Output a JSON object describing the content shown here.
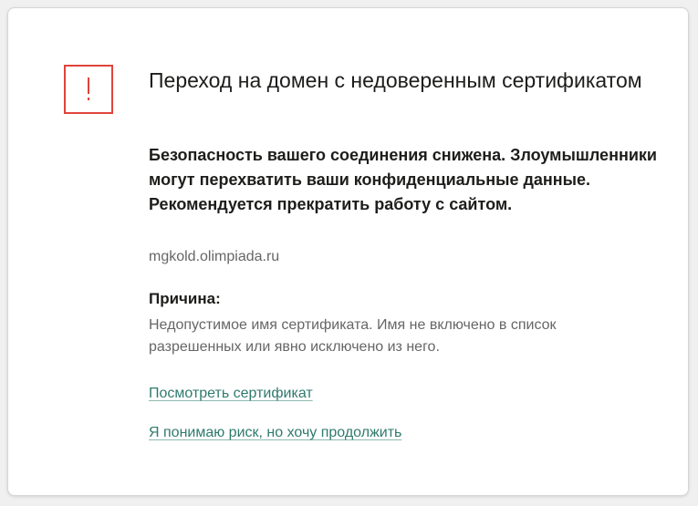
{
  "colors": {
    "accent_warning": "#e0433a",
    "link": "#2f7a6d",
    "text_primary": "#1d1d1b",
    "text_secondary": "#666666"
  },
  "icon": "exclamation-warning-icon",
  "warning": {
    "title": "Переход на домен с недоверенным сертификатом",
    "lead": "Безопасность вашего соединения снижена. Злоумышленники могут перехватить ваши конфиденциальные данные. Рекомендуется прекратить работу с сайтом.",
    "domain": "mgkold.olimpiada.ru",
    "reason_heading": "Причина:",
    "reason_text": "Недопустимое имя сертификата. Имя не включено в список разрешенных или явно исключено из него.",
    "view_certificate_link": "Посмотреть сертификат",
    "proceed_link": "Я понимаю риск, но хочу продолжить"
  }
}
